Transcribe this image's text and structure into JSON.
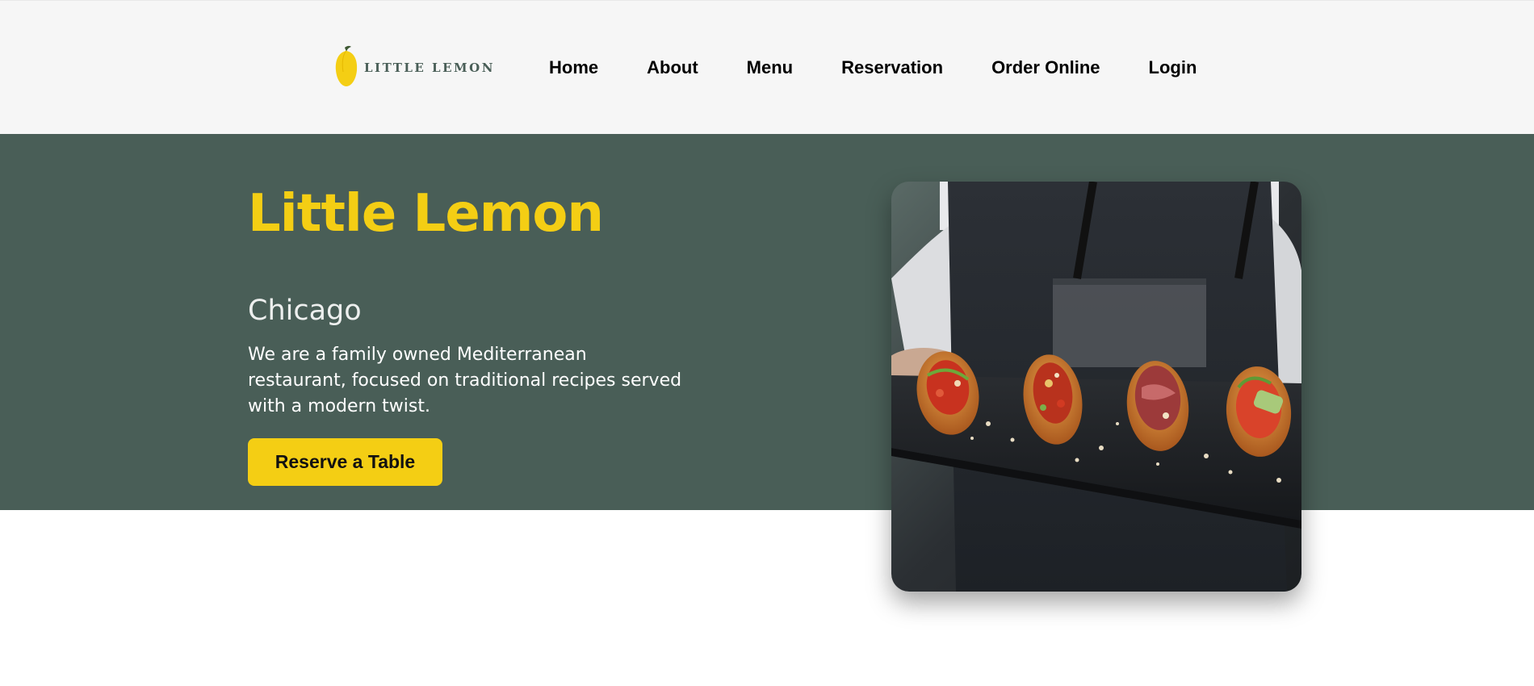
{
  "brand": {
    "logo_text": "LITTLE LEMON",
    "logo_icon": "lemon-icon",
    "accent_color": "#f4ce14",
    "primary_color": "#495e57"
  },
  "nav": {
    "items": [
      {
        "label": "Home"
      },
      {
        "label": "About"
      },
      {
        "label": "Menu"
      },
      {
        "label": "Reservation"
      },
      {
        "label": "Order Online"
      },
      {
        "label": "Login"
      }
    ]
  },
  "hero": {
    "title": "Little Lemon",
    "subtitle": "Chicago",
    "description": "We are a family owned Mediterranean restaurant, focused on traditional recipes served with a modern twist.",
    "cta_label": "Reserve a Table",
    "image_alt": "restaurant food"
  }
}
